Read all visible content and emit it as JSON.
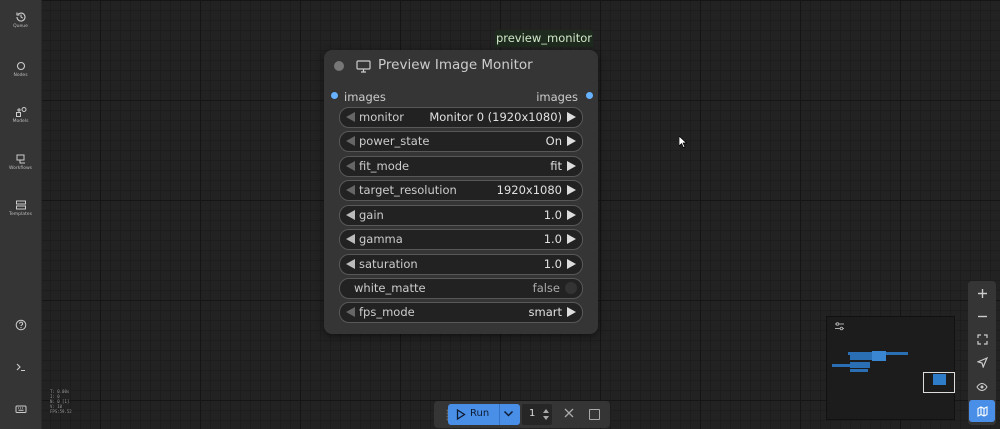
{
  "sidebar": {
    "items": [
      {
        "label": "Queue",
        "icon": "history-icon"
      },
      {
        "label": "Nodes",
        "icon": "circle-icon"
      },
      {
        "label": "Models",
        "icon": "models-icon"
      },
      {
        "label": "Workflows",
        "icon": "workflows-icon"
      },
      {
        "label": "Templates",
        "icon": "templates-icon"
      }
    ],
    "stats": [
      "T: 0.00s",
      "I: 0",
      "N: 0 [1]",
      "V: 10",
      "FPS:59.52"
    ]
  },
  "node": {
    "badge": "preview_monitor",
    "title": "Preview Image Monitor",
    "input_label": "images",
    "output_label": "images",
    "widgets": [
      {
        "label": "monitor",
        "value": "Monitor 0 (1920x1080)"
      },
      {
        "label": "power_state",
        "value": "On"
      },
      {
        "label": "fit_mode",
        "value": "fit"
      },
      {
        "label": "target_resolution",
        "value": "1920x1080"
      },
      {
        "label": "gain",
        "value": "1.0"
      },
      {
        "label": "gamma",
        "value": "1.0"
      },
      {
        "label": "saturation",
        "value": "1.0"
      },
      {
        "label": "white_matte",
        "value": "false"
      },
      {
        "label": "fps_mode",
        "value": "smart"
      }
    ]
  },
  "runbar": {
    "run_label": "Run",
    "queue_count": "1"
  },
  "colors": {
    "accent": "#4a8fe7",
    "slot": "#67b2ff",
    "node_bg": "#353535",
    "canvas_bg": "#222222"
  }
}
